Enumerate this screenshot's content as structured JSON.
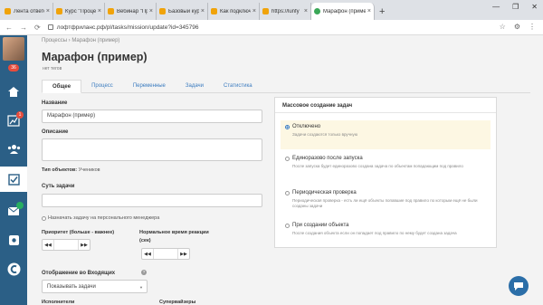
{
  "browser": {
    "tabs": [
      {
        "label": "Лента ответов",
        "active": false
      },
      {
        "label": "Курс \"Процесс",
        "active": false
      },
      {
        "label": "Вебинар \"Проце",
        "active": false
      },
      {
        "label": "Базовый курс по",
        "active": false
      },
      {
        "label": "Как подключить",
        "active": false
      },
      {
        "label": "https://lunfy",
        "active": false
      },
      {
        "label": "Марафон (приме",
        "active": true
      }
    ],
    "url": "лофтфриланс.рф/pl/tasks/mission/update?id=345796"
  },
  "sidebar": {
    "badge": "36",
    "items": [
      {
        "name": "home-icon",
        "badge": ""
      },
      {
        "name": "chart-icon",
        "badge": "1"
      },
      {
        "name": "users-icon",
        "badge": ""
      },
      {
        "name": "tasks-icon",
        "badge": ""
      },
      {
        "name": "mail-icon",
        "badge": ""
      },
      {
        "name": "settings-icon",
        "badge": ""
      },
      {
        "name": "logo-icon",
        "badge": ""
      }
    ]
  },
  "page": {
    "breadcrumb": "Процессы › Марафон (пример)",
    "title": "Марафон (пример)",
    "subtitle": "нет тегов",
    "tabs": [
      "Общее",
      "Процесс",
      "Переменные",
      "Задачи",
      "Статистика"
    ],
    "active_tab": "Общее"
  },
  "form": {
    "name_label": "Название",
    "name_value": "Марафон (пример)",
    "desc_label": "Описание",
    "object_type_label": "Тип объектов:",
    "object_type_value": "Учеников",
    "task_essence_label": "Суть задачи",
    "assign_manager_label": "Назначать задачу на персонального менеджера",
    "priority_label": "Приоритет (больше - важнее)",
    "normal_time_label": "Нормальное время реакции",
    "normal_time_unit": "(сек)",
    "inbox_display_label": "Отображение во Входящих",
    "inbox_display_value": "Показывать задачи",
    "executors_label": "Исполнители",
    "supervisors_label": "Супервайзеры"
  },
  "mass_creation": {
    "title": "Массовое создание задач",
    "options": [
      {
        "label": "Отключено",
        "desc": "Задачи создаются только вручную",
        "selected": true
      },
      {
        "label": "Единоразово после запуска",
        "desc": "После запуска будет единоразово создана задача по объектам попадающим под правило",
        "selected": false
      },
      {
        "label": "Периодическая проверка",
        "desc": "Периодическая проверка - есть ли ещё объекты попавшие под правило по которым ещё не были созданы задачи",
        "selected": false
      },
      {
        "label": "При создании объекта",
        "desc": "После создания объекта если он попадает под правило по нему будет создана задача",
        "selected": false
      }
    ]
  },
  "colors": {
    "sidebar": "#2b5f86",
    "accent": "#3a7bbf",
    "selected_option": "#fdf7e3"
  }
}
